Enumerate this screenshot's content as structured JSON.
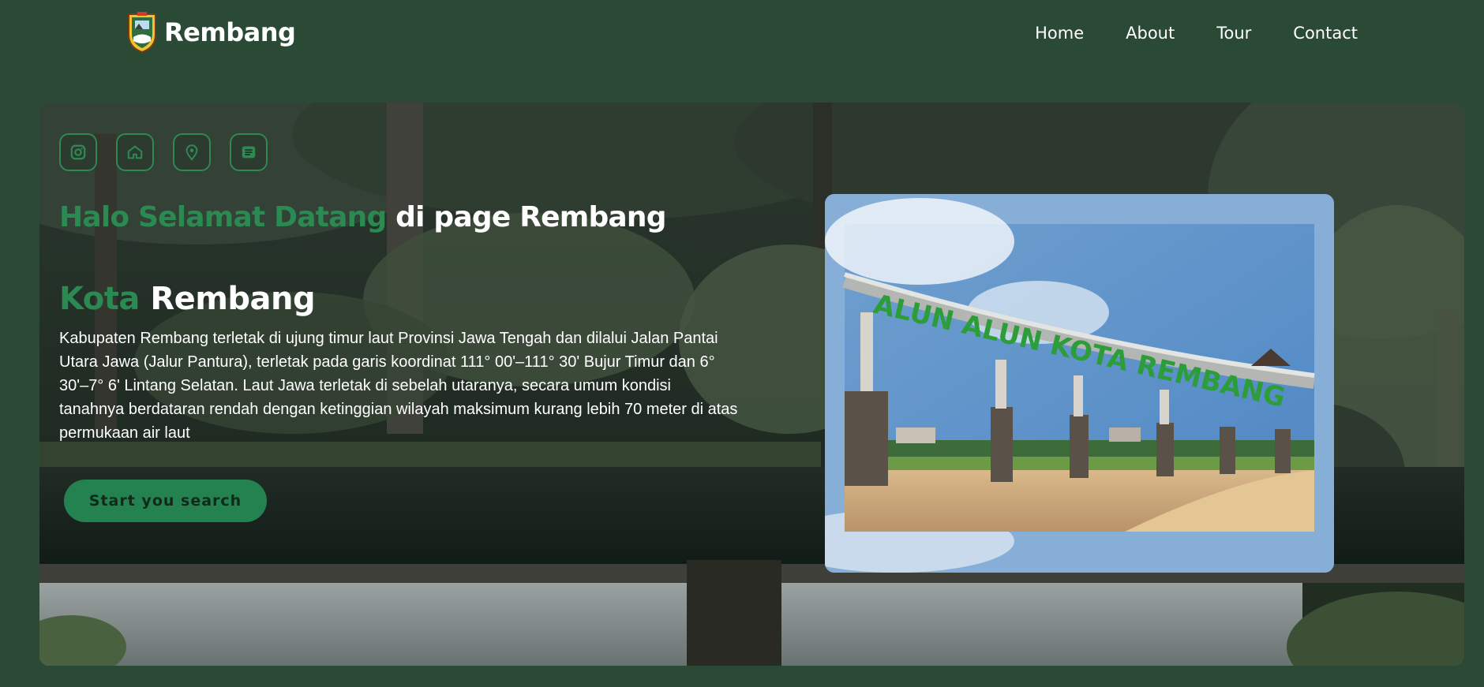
{
  "brand": {
    "name": "Rembang",
    "logo_icon": "rembang-crest-icon"
  },
  "nav": {
    "items": [
      {
        "label": "Home"
      },
      {
        "label": "About"
      },
      {
        "label": "Tour"
      },
      {
        "label": "Contact"
      }
    ]
  },
  "hero": {
    "background": "forest-waterfall-photo",
    "social_icons": [
      {
        "icon": "instagram-icon"
      },
      {
        "icon": "home-icon"
      },
      {
        "icon": "location-pin-icon"
      },
      {
        "icon": "message-icon"
      }
    ],
    "greeting": {
      "accent": "Halo Selamat Datang",
      "rest": " di page Rembang"
    },
    "title": {
      "accent": "Kota",
      "rest": " Rembang"
    },
    "description": "Kabupaten Rembang terletak di ujung timur laut Provinsi Jawa Tengah dan dilalui Jalan Pantai Utara Jawa (Jalur Pantura), terletak pada garis koordinat 111° 00'–111° 30' Bujur Timur dan 6° 30'–7° 6' Lintang Selatan. Laut Jawa terletak di sebelah utaranya, secara umum kondisi tanahnya berdataran rendah dengan ketinggian wilayah maksimum kurang lebih 70 meter di atas permukaan air laut",
    "cta_label": "Start you search",
    "photo": {
      "sign_text": "ALUN ALUN KOTA REMBANG"
    }
  },
  "colors": {
    "page_bg": "#2a4a36",
    "accent": "#2a8a52",
    "button_bg": "#23824f",
    "button_text": "#0f2a1a"
  }
}
